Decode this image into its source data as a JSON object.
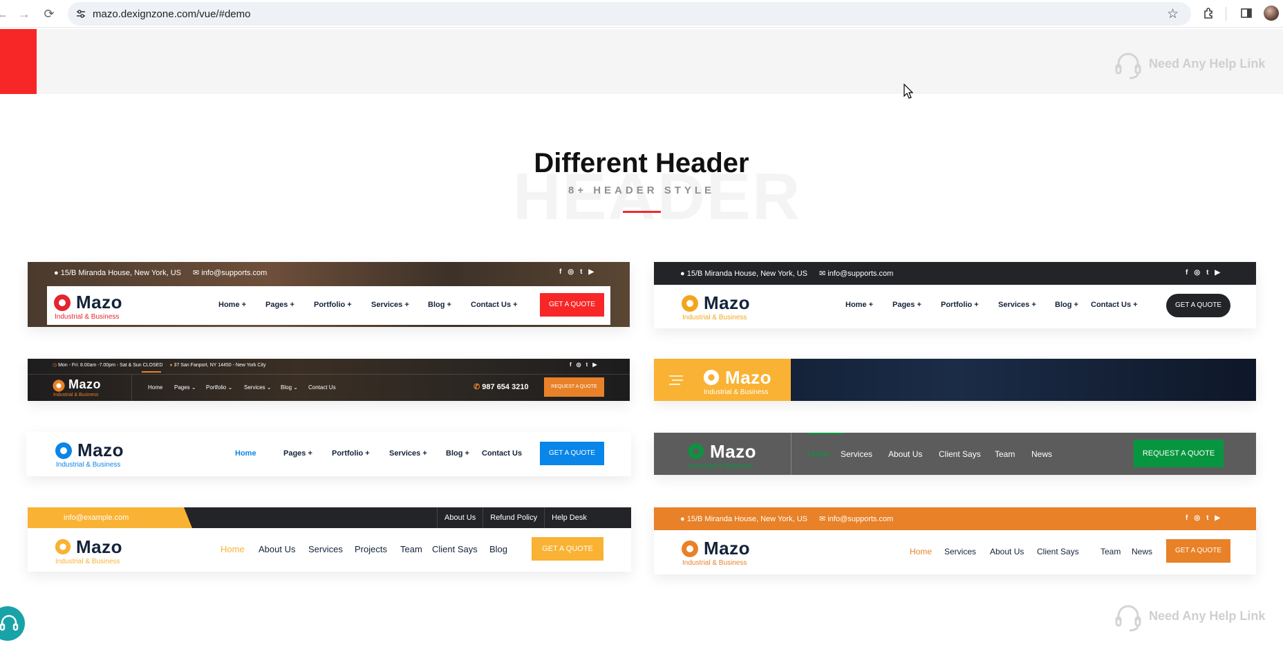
{
  "browser": {
    "back": "←",
    "forward": "→",
    "reload": "⟳",
    "url": "mazo.dexignzone.com/vue/#demo",
    "icons": [
      "tune-icon",
      "star-icon",
      "extensions-icon",
      "sidebar-icon",
      "profile-avatar"
    ]
  },
  "help_link": "Need Any Help Link",
  "section": {
    "ghost": "HEADER",
    "title": "Different Header",
    "subtitle": "8+ HEADER STYLE"
  },
  "colors": {
    "red": "#f82727",
    "orange": "#e88128",
    "yellow": "#f9b233",
    "blue": "#0a85e8",
    "green": "#07963f",
    "dark": "#222427"
  },
  "brand": {
    "name": "Mazo",
    "tag": "Industrial & Business"
  },
  "h1": {
    "address": "15/B Miranda House, New York, US",
    "email": "info@supports.com",
    "menu": [
      "Home",
      "Pages",
      "Portfolio",
      "Services",
      "Blog",
      "Contact Us"
    ],
    "cta": "GET A QUOTE"
  },
  "h2": {
    "address": "15/B Miranda House, New York, US",
    "email": "info@supports.com",
    "menu": [
      "Home",
      "Pages",
      "Portfolio",
      "Services",
      "Blog",
      "Contact Us"
    ],
    "cta": "GET A QUOTE"
  },
  "h3": {
    "hours": "Mon - Fri: 8.00am -7.00pm - Sat & Sun CLOSED",
    "address": "37 San Fanport, NY 14450 - New York City",
    "menu": [
      "Home",
      "Pages",
      "Portfolio",
      "Services",
      "Blog",
      "Contact Us"
    ],
    "phone": "987 654 3210",
    "cta": "REQUEST A QUOTE"
  },
  "h5": {
    "menu": [
      "Home",
      "Pages",
      "Portfolio",
      "Services",
      "Blog",
      "Contact Us"
    ],
    "cta": "GET A QUOTE"
  },
  "h6": {
    "menu": [
      "Home",
      "Services",
      "About Us",
      "Client Says",
      "Team",
      "News"
    ],
    "cta": "REQUEST A QUOTE"
  },
  "h7": {
    "email": "info@example.com",
    "links": [
      "About Us",
      "Refund Policy",
      "Help Desk"
    ],
    "menu": [
      "Home",
      "About Us",
      "Services",
      "Projects",
      "Team",
      "Client Says",
      "Blog"
    ],
    "cta": "GET A QUOTE"
  },
  "h8": {
    "address": "15/B Miranda House, New York, US",
    "email": "info@supports.com",
    "menu": [
      "Home",
      "Services",
      "About Us",
      "Client Says",
      "Team",
      "News"
    ],
    "cta": "GET A QUOTE"
  }
}
